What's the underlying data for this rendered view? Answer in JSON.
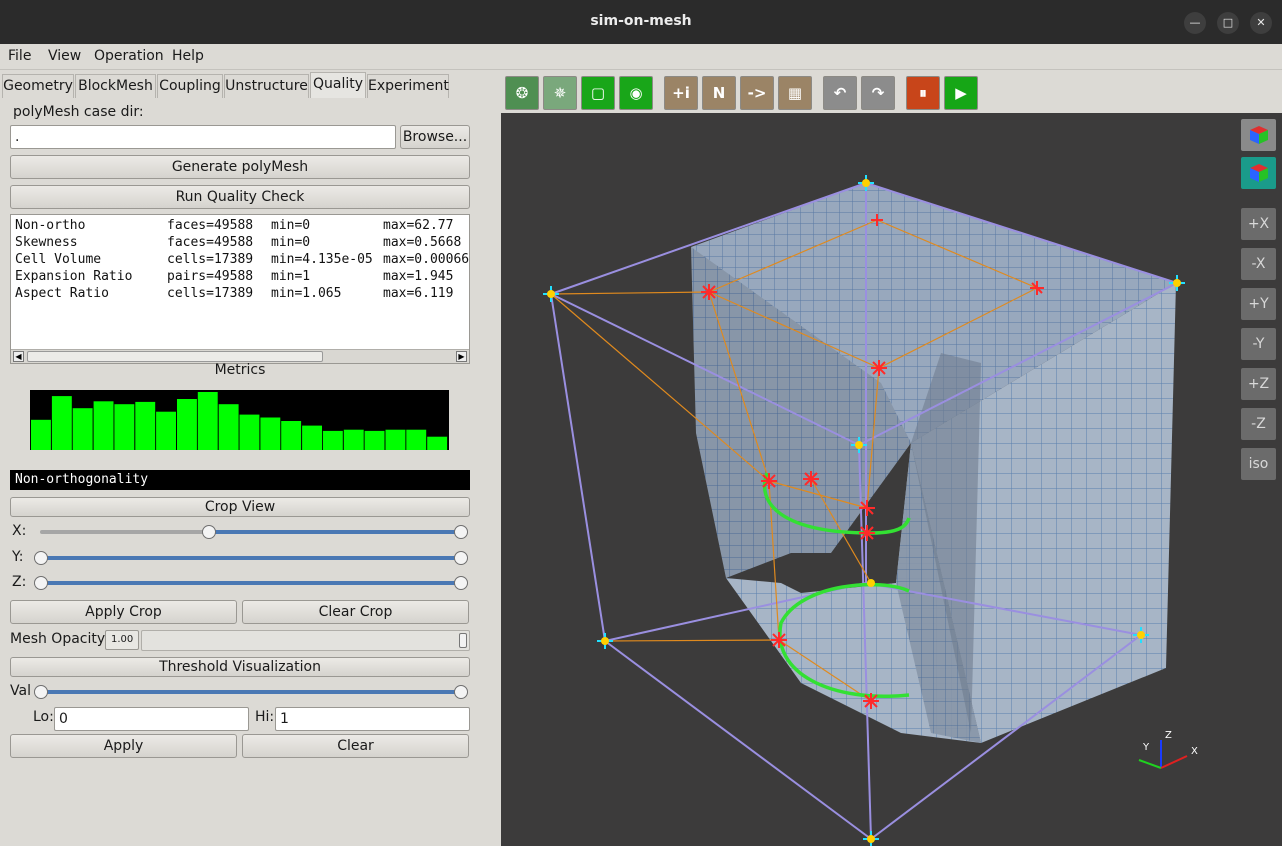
{
  "window": {
    "title": "sim-on-mesh"
  },
  "menu": [
    "File",
    "View",
    "Operation",
    "Help"
  ],
  "tabs": [
    "Geometry",
    "BlockMesh",
    "Coupling",
    "Unstructure",
    "Quality",
    "Experiment"
  ],
  "active_tab": "Quality",
  "case": {
    "label": "polyMesh case dir:",
    "value": ".",
    "browse": "Browse..."
  },
  "buttons": {
    "generate": "Generate polyMesh",
    "run_quality": "Run Quality Check",
    "apply_crop": "Apply Crop",
    "clear_crop": "Clear Crop",
    "apply": "Apply",
    "clear": "Clear"
  },
  "report_rows": [
    [
      "Non-ortho",
      "faces=49588",
      "min=0",
      "max=62.77"
    ],
    [
      "Skewness",
      "faces=49588",
      "min=0",
      "max=0.5668"
    ],
    [
      "Cell Volume",
      "cells=17389",
      "min=4.135e-05",
      "max=0.00066"
    ],
    [
      "Expansion Ratio",
      "pairs=49588",
      "min=1",
      "max=1.945"
    ],
    [
      "Aspect Ratio",
      "cells=17389",
      "min=1.065",
      "max=6.119"
    ]
  ],
  "metrics": {
    "title": "Metrics",
    "histogram": [
      0.52,
      0.93,
      0.72,
      0.84,
      0.79,
      0.83,
      0.66,
      0.88,
      1.0,
      0.79,
      0.61,
      0.56,
      0.5,
      0.42,
      0.33,
      0.35,
      0.33,
      0.35,
      0.35,
      0.23
    ],
    "bar_color": "#00ff00",
    "selected": "Non-orthogonality"
  },
  "crop": {
    "header": "Crop View",
    "x_label": "X:",
    "y_label": "Y:",
    "z_label": "Z:",
    "x_range": [
      0.4,
      1.0
    ],
    "y_range": [
      0.0,
      1.0
    ],
    "z_range": [
      0.0,
      1.0
    ]
  },
  "opacity": {
    "label": "Mesh Opacity:",
    "value": "1.00",
    "level": 1.0
  },
  "threshold": {
    "header": "Threshold Visualization",
    "val_label": "Val",
    "val_range": [
      0.0,
      1.0
    ],
    "lo_label": "Lo:",
    "lo_value": "0",
    "hi_label": "Hi:",
    "hi_value": "1"
  },
  "toolbar": [
    {
      "icon": "wireframe-sphere-icon",
      "text": "",
      "color": "#4f8f52"
    },
    {
      "icon": "points-sphere-icon",
      "text": "",
      "color": "#7aa87c"
    },
    {
      "icon": "select-face-icon",
      "text": "",
      "color": "#19a619"
    },
    {
      "icon": "select-point-icon",
      "text": "",
      "color": "#19a619"
    },
    {
      "icon": "add-info-icon",
      "text": "+i",
      "color": "#9b8466"
    },
    {
      "icon": "node-icon",
      "text": "N",
      "color": "#9b8466"
    },
    {
      "icon": "arrow-right-icon",
      "text": "->",
      "color": "#9b8466"
    },
    {
      "icon": "mesh-cube-icon",
      "text": "",
      "color": "#9b8466"
    },
    {
      "icon": "undo-icon",
      "text": "",
      "color": "#8c8c8c"
    },
    {
      "icon": "redo-icon",
      "text": "",
      "color": "#8c8c8c"
    },
    {
      "icon": "pause-icon",
      "text": "",
      "color": "#c8451a"
    },
    {
      "icon": "play-icon",
      "text": "",
      "color": "#16a616"
    }
  ],
  "view_buttons": [
    "+X",
    "-X",
    "+Y",
    "-Y",
    "+Z",
    "-Z",
    "iso"
  ],
  "axes": {
    "x": "X",
    "y": "Y",
    "z": "Z"
  },
  "colors": {
    "accent_green": "#00ff00",
    "viewport_bg": "#3c3b3b",
    "panel_bg": "#dcdad5"
  }
}
